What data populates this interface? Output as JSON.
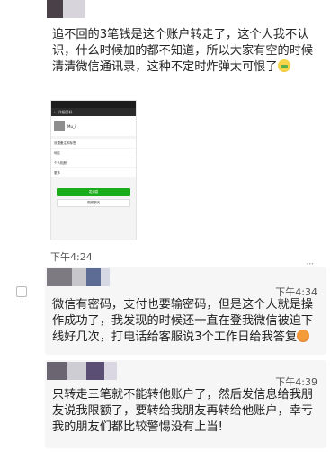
{
  "messages": [
    {
      "text": "追不回的3笔钱是这个账户转走了，这个人我不认识，什么时候加的都不知道，所以大家有空的时候清清微信通讯录，这种不定时炸弹太可恨了",
      "time": "下午4:24",
      "screenshot": {
        "title": "详细资料",
        "name": "Mu_i",
        "rows": [
          "设置备注和标签",
          "地区",
          "个人相册",
          "更多"
        ],
        "primary_button": "发消息",
        "secondary_button": "视频聊天"
      }
    },
    {
      "time": "下午4:34",
      "text": "微信有密码，支付也要输密码，但是这个人就是操作成功了，我发现的时候还一直在登我微信被迫下线好几次，打电话给客服说3个工作日给我答复"
    },
    {
      "time": "下午4:39",
      "text": "只转走三笔就不能转他账户了，然后发信息给我朋友说我限额了，要转给我朋友再转给他账户，幸亏我的朋友们都比较警惕没有上当!"
    }
  ],
  "colors": {
    "bubble": "#f6f6f6",
    "wechat_green": "#1aad19"
  },
  "icons": [
    "money-face-emoji",
    "angry-face-emoji",
    "more-dots-icon"
  ]
}
